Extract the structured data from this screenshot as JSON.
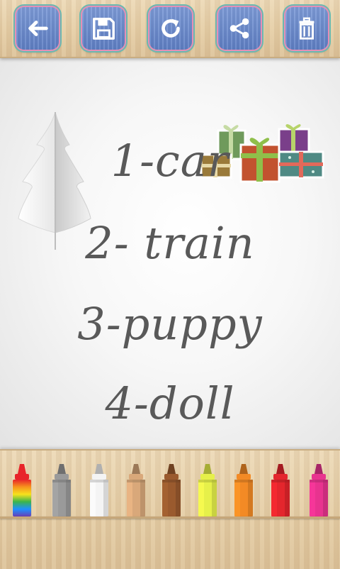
{
  "toolbar": {
    "buttons": [
      {
        "name": "back-button",
        "icon": "arrow-left-icon"
      },
      {
        "name": "save-button",
        "icon": "floppy-disk-icon"
      },
      {
        "name": "redo-button",
        "icon": "circular-arrow-icon"
      },
      {
        "name": "share-button",
        "icon": "share-icon"
      },
      {
        "name": "delete-button",
        "icon": "trash-icon"
      }
    ],
    "accent": "#6a88cc"
  },
  "canvas": {
    "lines": [
      "1-car",
      "2- train",
      "3-puppy",
      "4-doll"
    ],
    "ink_color": "#595959",
    "decorations": [
      "paper-christmas-tree-icon",
      "gift-boxes-icon"
    ]
  },
  "palette": {
    "markers": [
      {
        "name": "rainbow",
        "color": "#e8242a"
      },
      {
        "name": "gray",
        "color": "#9a9a9a"
      },
      {
        "name": "white",
        "color": "#f4f4f4"
      },
      {
        "name": "tan",
        "color": "#d9a87a"
      },
      {
        "name": "brown",
        "color": "#9a5a2e"
      },
      {
        "name": "yellow-green",
        "color": "#e6f04a"
      },
      {
        "name": "orange",
        "color": "#f38a25"
      },
      {
        "name": "red",
        "color": "#e4262d"
      },
      {
        "name": "pink",
        "color": "#e8338f"
      }
    ],
    "selected": "rainbow"
  }
}
